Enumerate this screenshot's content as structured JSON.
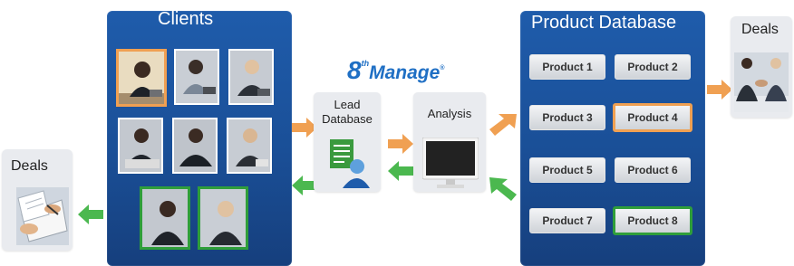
{
  "deals_left": {
    "title": "Deals"
  },
  "deals_right": {
    "title": "Deals"
  },
  "clients": {
    "title": "Clients"
  },
  "logo": {
    "numeral": "8",
    "superscript": "th",
    "name": "Manage",
    "mark": "®"
  },
  "lead_database": {
    "line1": "Lead",
    "line2": "Database"
  },
  "analysis": {
    "label": "Analysis"
  },
  "product_database": {
    "title": "Product Database",
    "products": [
      "Product 1",
      "Product 2",
      "Product 3",
      "Product 4",
      "Product 5",
      "Product 6",
      "Product 7",
      "Product 8"
    ]
  },
  "colors": {
    "panel_blue": "#1a4f97",
    "arrow_orange": "#f0a052",
    "arrow_green": "#4bb84f",
    "highlight_orange": "#f0a052",
    "highlight_green": "#2f9e3a",
    "logo_blue": "#1f6fc4"
  }
}
